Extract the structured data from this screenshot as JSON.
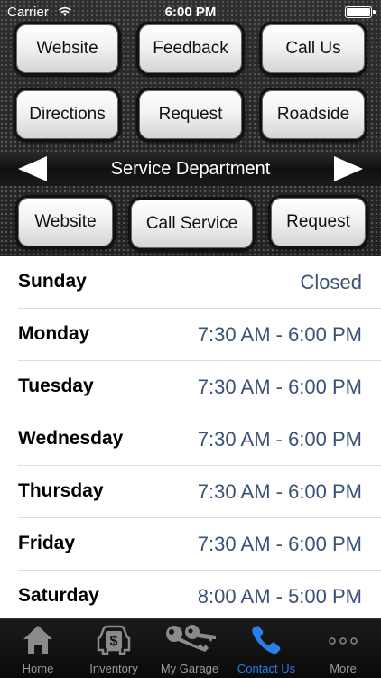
{
  "status_bar": {
    "carrier": "Carrier",
    "time": "6:00 PM"
  },
  "top_buttons": {
    "website": "Website",
    "feedback": "Feedback",
    "call_us": "Call Us",
    "directions": "Directions",
    "request": "Request",
    "roadside": "Roadside"
  },
  "department": {
    "title": "Service Department",
    "website": "Website",
    "call_service": "Call Service",
    "request": "Request"
  },
  "hours": [
    {
      "day": "Sunday",
      "time": "Closed"
    },
    {
      "day": "Monday",
      "time": "7:30 AM - 6:00 PM"
    },
    {
      "day": "Tuesday",
      "time": "7:30 AM - 6:00 PM"
    },
    {
      "day": "Wednesday",
      "time": "7:30 AM - 6:00 PM"
    },
    {
      "day": "Thursday",
      "time": "7:30 AM - 6:00 PM"
    },
    {
      "day": "Friday",
      "time": "7:30 AM - 6:00 PM"
    },
    {
      "day": "Saturday",
      "time": "8:00 AM - 5:00 PM"
    }
  ],
  "tabs": [
    {
      "label": "Home",
      "icon": "home-icon"
    },
    {
      "label": "Inventory",
      "icon": "car-dollar-icon"
    },
    {
      "label": "My Garage",
      "icon": "keys-icon"
    },
    {
      "label": "Contact Us",
      "icon": "phone-icon"
    },
    {
      "label": "More",
      "icon": "more-dots-icon"
    }
  ],
  "colors": {
    "accent": "#2a7dea",
    "hours_time": "#3a5178"
  }
}
